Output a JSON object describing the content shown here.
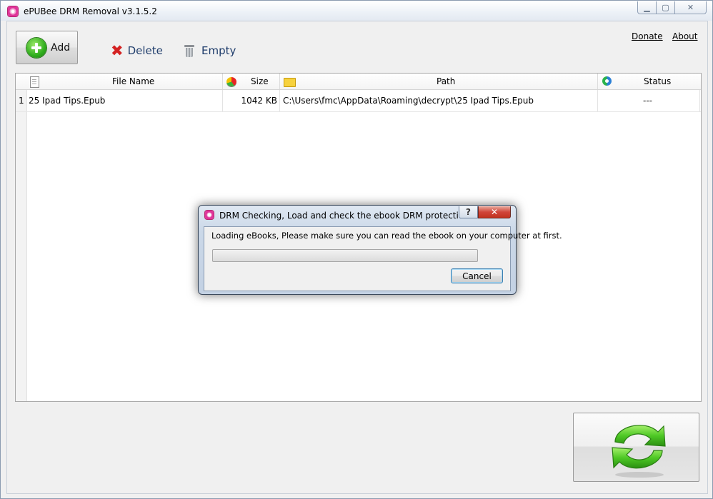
{
  "window": {
    "title": "ePUBee DRM Removal v3.1.5.2",
    "controls": {
      "minimize": "▁",
      "maximize": "▢",
      "close": "✕"
    }
  },
  "toolbar": {
    "add_label": "Add",
    "delete_label": "Delete",
    "empty_label": "Empty",
    "donate_label": "Donate",
    "about_label": "About"
  },
  "table": {
    "columns": [
      "File Name",
      "Size",
      "Path",
      "Status"
    ],
    "rows": [
      {
        "index": "1",
        "file_name": "25 Ipad Tips.Epub",
        "size": "1042 KB",
        "path": "C:\\Users\\fmc\\AppData\\Roaming\\decrypt\\25 Ipad Tips.Epub",
        "status": "---"
      }
    ]
  },
  "dialog": {
    "title": "DRM Checking, Load and check the ebook DRM protection.",
    "help_label": "?",
    "close_label": "✕",
    "message": "Loading eBooks, Please make sure you can read the ebook on your computer at first.",
    "progress": 0.0,
    "cancel_label": "Cancel"
  },
  "icons": {
    "app": "epubee-app-icon",
    "add": "plus-circle-icon",
    "delete": "red-x-icon",
    "empty": "trash-icon",
    "convert": "green-refresh-arrows-icon"
  },
  "colors": {
    "accent_green": "#2fae1d",
    "delete_red": "#d42222",
    "link_text": "#1e3c6b"
  }
}
